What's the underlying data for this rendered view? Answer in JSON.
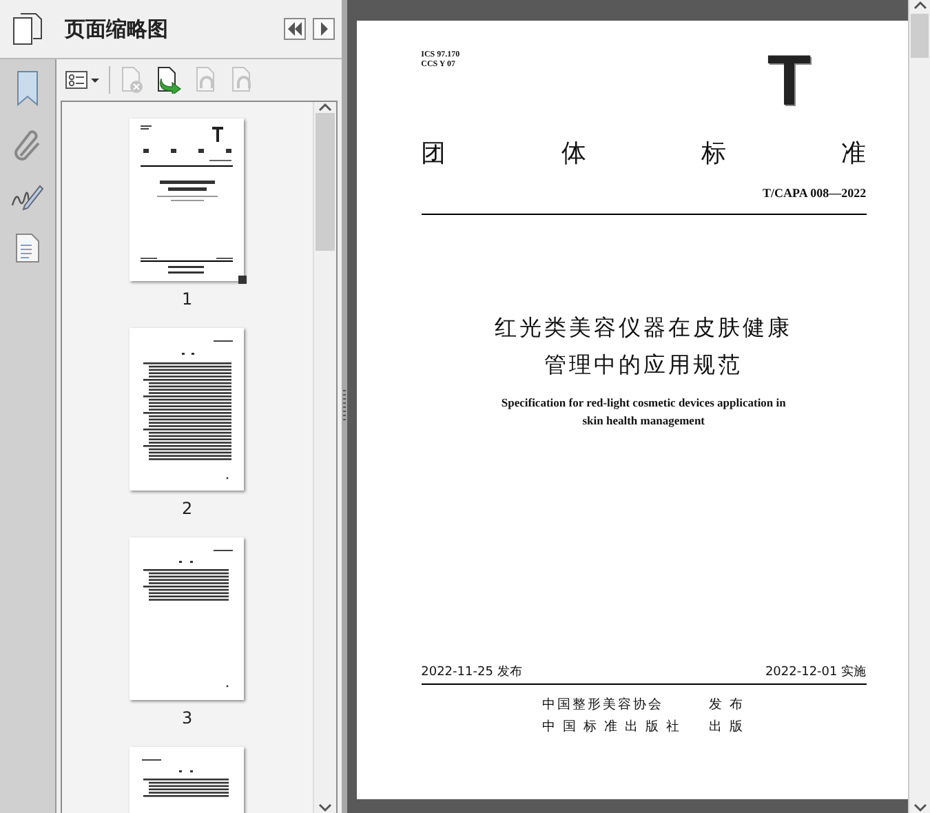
{
  "panel": {
    "title": "页面缩略图"
  },
  "toolbar": [
    {
      "kind": "options",
      "disabled": false
    },
    {
      "kind": "delete",
      "disabled": true
    },
    {
      "kind": "insert",
      "disabled": false
    },
    {
      "kind": "undo",
      "disabled": true
    },
    {
      "kind": "redo",
      "disabled": true
    }
  ],
  "thumbnails": [
    {
      "kind": "cover",
      "label": "1",
      "selected": true
    },
    {
      "kind": "contents",
      "label": "2",
      "selected": false
    },
    {
      "kind": "text",
      "label": "3",
      "selected": false
    },
    {
      "kind": "text-short",
      "selected": false
    }
  ],
  "document": {
    "classification": [
      "ICS 97.170",
      "CCS Y 07"
    ],
    "logo": "T",
    "standard_type": "团体标准",
    "number": "T/CAPA 008—2022",
    "title": [
      "红光类美容仪器在皮肤健康",
      "管理中的应用规范"
    ],
    "subtitle": [
      "Specification for red-light cosmetic devices application in",
      "skin health management"
    ],
    "issued": "2022-11-25 发布",
    "effective": "2022-12-01 实施",
    "publishers": [
      {
        "name": "中国整形美容协会",
        "role": "发 布"
      },
      {
        "name": "中 国 标 准 出 版 社",
        "role": "出 版"
      }
    ]
  }
}
